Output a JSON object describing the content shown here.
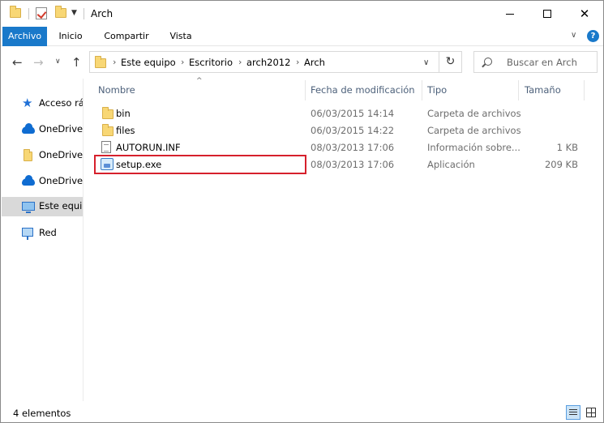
{
  "window": {
    "title": "Arch"
  },
  "ribbon": {
    "tabs": [
      "Archivo",
      "Inicio",
      "Compartir",
      "Vista"
    ],
    "help_label": "?"
  },
  "address_bar": {
    "crumbs": [
      "Este equipo",
      "Escritorio",
      "arch2012",
      "Arch"
    ]
  },
  "search": {
    "placeholder": "Buscar en Arch"
  },
  "nav_pane": {
    "items": [
      {
        "label": "Acceso ráp",
        "icon": "star-icon"
      },
      {
        "label": "OneDrive",
        "icon": "cloud-icon"
      },
      {
        "label": "OneDrive",
        "icon": "folder-icon"
      },
      {
        "label": "OneDrive",
        "icon": "cloud-icon"
      },
      {
        "label": "Este equip",
        "icon": "monitor-icon",
        "selected": true
      },
      {
        "label": "Red",
        "icon": "network-icon"
      }
    ]
  },
  "columns": {
    "name": "Nombre",
    "modified": "Fecha de modificación",
    "type": "Tipo",
    "size": "Tamaño"
  },
  "files": [
    {
      "name": "bin",
      "modified": "06/03/2015 14:14",
      "type": "Carpeta de archivos",
      "size": "",
      "icon": "folder-icon"
    },
    {
      "name": "files",
      "modified": "06/03/2015 14:22",
      "type": "Carpeta de archivos",
      "size": "",
      "icon": "folder-icon"
    },
    {
      "name": "AUTORUN.INF",
      "modified": "08/03/2013 17:06",
      "type": "Información sobre...",
      "size": "1 KB",
      "icon": "inf-file-icon"
    },
    {
      "name": "setup.exe",
      "modified": "08/03/2013 17:06",
      "type": "Aplicación",
      "size": "209 KB",
      "icon": "exe-file-icon",
      "highlighted": true
    }
  ],
  "status": {
    "item_count": "4 elementos"
  },
  "colors": {
    "accent": "#1979ca",
    "highlight_border": "#d6202c",
    "header_text": "#4c607a"
  }
}
